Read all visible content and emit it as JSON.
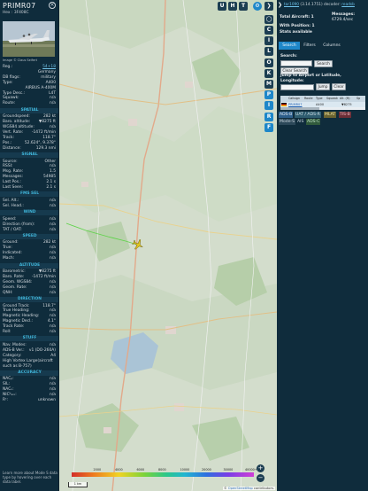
{
  "aircraft": {
    "callsign": "PRIMR07",
    "hex_label": "Hex :",
    "hex": "3F408C",
    "photo_credit": "Image © Claus Seifert"
  },
  "details": [
    {
      "k": "Reg.:",
      "v": "54+18",
      "link": true
    },
    {
      "k": "",
      "v": "Germany"
    },
    {
      "k": "DB flags:",
      "v": "military"
    },
    {
      "k": "Type:",
      "v": "A400"
    },
    {
      "k": "",
      "v": "AIRBUS A-400M"
    },
    {
      "k": "Type Desc.:",
      "v": "L4T"
    },
    {
      "k": "Squawk:",
      "v": "n/a"
    },
    {
      "k": "Route:",
      "v": "n/a"
    }
  ],
  "spatial": {
    "title": "SPATIAL",
    "rows": [
      {
        "k": "Groundspeed:",
        "v": "282 kt"
      },
      {
        "k": "Baro. altitude:",
        "v": "▼8275 ft"
      },
      {
        "k": "WGS84 altitude:",
        "v": "n/a"
      },
      {
        "k": "Vert. Rate:",
        "v": "-1472 ft/min"
      },
      {
        "k": "Track:",
        "v": "118.7°"
      },
      {
        "k": "Pos.:",
        "v": "52.624°, 9.378°"
      },
      {
        "k": "Distance:",
        "v": "129.3 nmi"
      }
    ]
  },
  "signal": {
    "title": "SIGNAL",
    "rows": [
      {
        "k": "Source:",
        "v": "Other"
      },
      {
        "k": "RSSI:",
        "v": "n/a"
      },
      {
        "k": "Msg. Rate:",
        "v": "1.5"
      },
      {
        "k": "Messages:",
        "v": "54985"
      },
      {
        "k": "Last Pos.:",
        "v": "2.1 s"
      },
      {
        "k": "Last Seen:",
        "v": "2.1 s"
      }
    ]
  },
  "fms": {
    "title": "FMS SEL",
    "rows": [
      {
        "k": "Sel. Alt.:",
        "v": "n/a"
      },
      {
        "k": "Sel. Head.:",
        "v": "n/a"
      }
    ]
  },
  "wind": {
    "title": "WIND",
    "rows": [
      {
        "k": "Speed:",
        "v": "n/a"
      },
      {
        "k": "Direction (from):",
        "v": "n/a"
      },
      {
        "k": "TAT / OAT:",
        "v": "n/a"
      }
    ]
  },
  "speed": {
    "title": "SPEED",
    "rows": [
      {
        "k": "Ground:",
        "v": "282 kt"
      },
      {
        "k": "True:",
        "v": "n/a"
      },
      {
        "k": "Indicated:",
        "v": "n/a"
      },
      {
        "k": "Mach:",
        "v": "n/a"
      }
    ]
  },
  "altitude": {
    "title": "ALTITUDE",
    "rows": [
      {
        "k": "Barometric:",
        "v": "▼8275 ft"
      },
      {
        "k": "Baro. Rate:",
        "v": "-1472 ft/min"
      },
      {
        "k": "Geom. WGS84:",
        "v": "n/a"
      },
      {
        "k": "Geom. Rate:",
        "v": "n/a"
      },
      {
        "k": "QNH:",
        "v": "n/a"
      }
    ]
  },
  "direction": {
    "title": "DIRECTION",
    "rows": [
      {
        "k": "Ground Track:",
        "v": "118.7°"
      },
      {
        "k": "True Heading:",
        "v": "n/a"
      },
      {
        "k": "Magnetic Heading:",
        "v": "n/a"
      },
      {
        "k": "Magnetic Decl.:",
        "v": "4.1°"
      },
      {
        "k": "Track Rate:",
        "v": "n/a"
      },
      {
        "k": "Roll:",
        "v": "n/a"
      }
    ]
  },
  "stuff": {
    "title": "STUFF",
    "rows": [
      {
        "k": "Nav. Modes:",
        "v": "n/a"
      },
      {
        "k": "ADS-B Ver.:",
        "v": "v1 (DO-260A)"
      },
      {
        "k": "Category:",
        "v": "A4"
      },
      {
        "k": "High Vortex Large(aircraft",
        "v": ""
      },
      {
        "k": "such as B-757)",
        "v": ""
      }
    ]
  },
  "accuracy": {
    "title": "ACCURACY",
    "rows": [
      {
        "k": "NACₚ:",
        "v": "n/a"
      },
      {
        "k": "SIL:",
        "v": "n/a"
      },
      {
        "k": "NACᵥ:",
        "v": "n/a"
      },
      {
        "k": "NICᵇₐᵣₒ:",
        "v": "n/a"
      },
      {
        "k": "Rᶜ:",
        "v": "unknown"
      }
    ]
  },
  "footer_note": "Learn more about Mode S data type by hovering over each data label.",
  "map": {
    "top_buttons": [
      "U",
      "H",
      "T"
    ],
    "side_buttons": [
      "C",
      "I",
      "L",
      "O",
      "K",
      "M",
      "P",
      "I",
      "R",
      "F"
    ],
    "zoom_in": "+",
    "zoom_out": "−",
    "scale_label": "1 km",
    "attribution_prefix": "©",
    "attribution_link": "OpenStreetMap",
    "attribution_suffix": "contributors.",
    "altitude_labels": [
      "",
      "2000",
      "4000",
      "6000",
      "8000",
      "10000",
      "20000",
      "30000",
      "40000+"
    ],
    "colors": {
      "track": "#5fd34a",
      "aircraft": "#e2c81e"
    }
  },
  "right": {
    "version_prefix": "tar1090",
    "version": "(3.14.1751) decoder:",
    "version_link": "readsb",
    "total_aircraft_label": "Total Aircraft:",
    "total_aircraft": "1",
    "messages_label": "Messages:",
    "messages_value": "6729.4/sec",
    "with_position_label": "With Position:",
    "with_position": "1",
    "stats": "Stats available",
    "tabs": [
      "Search",
      "Filters",
      "Columns"
    ],
    "search_label": "Search:",
    "search_button": "Search",
    "clear_search": "Clear Search",
    "jump_label": "Jump to Airport or Latitude, Longitude:",
    "jump_button": "Jump",
    "clear_button": "Clear",
    "table_columns": [
      "Callsign",
      "Route",
      "Type",
      "Squawk",
      "Alt. (ft)",
      "Sp"
    ],
    "table_row": {
      "flag": "DE",
      "callsign": "PRIMR07",
      "type": "A400",
      "alt": "▼8275"
    },
    "legend": [
      "ADS-B",
      "UAT / ADS-R",
      "MLAT",
      "TIS-B",
      "Mode-S",
      "AIS",
      "ADS-C"
    ]
  }
}
